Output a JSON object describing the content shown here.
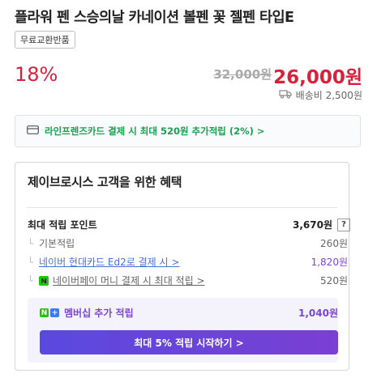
{
  "product": {
    "title": "플라워 펜 스승의날 카네이션 볼펜 꽃 젤펜 타입E",
    "badge": "무료교환반품",
    "discount": "18%",
    "original_price": "32,000원",
    "price": "26,000원",
    "shipping": "배송비 2,500원"
  },
  "card_banner": {
    "text": "라인프렌즈카드 결제 시 최대 520원 추가적립 (2%) >"
  },
  "benefits": {
    "title": "제이브로시스 고객을 위한 혜택",
    "max_points_label": "최대 적립 포인트",
    "max_points_value": "3,670원",
    "help": "?",
    "rows": [
      {
        "label": "기본적립",
        "value": "260원"
      },
      {
        "label": "네이버 현대카드 Ed2로 결제 시 >",
        "value": "1,820원"
      },
      {
        "label": "네이버페이 머니 결제 시 최대 적립 >",
        "value": "520원"
      }
    ],
    "membership_label": "멤버십 추가 적립",
    "membership_value": "1,040원",
    "cta": "최대 5% 적립 시작하기 >"
  },
  "colors": {
    "accent_red": "#d8223b",
    "green": "#1aa04e",
    "purple": "#7b45d6",
    "link_blue": "#4a6fdc"
  }
}
